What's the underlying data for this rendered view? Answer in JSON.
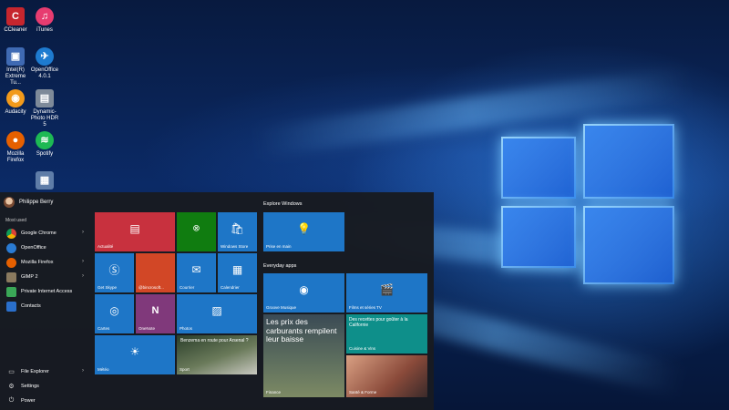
{
  "desktop": {
    "icons": [
      {
        "label": "CCleaner",
        "glyph": "C",
        "color": "#c6262e",
        "icon": "ccleaner-icon"
      },
      {
        "label": "iTunes",
        "glyph": "♫",
        "color": "#e73c70",
        "icon": "itunes-icon"
      },
      {
        "label": "Intel(R) Extreme Tu...",
        "glyph": "▣",
        "color": "#3f6ab3",
        "icon": "intel-icon"
      },
      {
        "label": "OpenOffice 4.0.1",
        "glyph": "✈",
        "color": "#1e7bd0",
        "icon": "openoffice-icon"
      },
      {
        "label": "Audacity",
        "glyph": "◉",
        "color": "#f29a1b",
        "icon": "audacity-icon"
      },
      {
        "label": "Dynamic-Photo HDR 5",
        "glyph": "▤",
        "color": "#7e8a99",
        "icon": "dynamic-photo-icon"
      },
      {
        "label": "Mozilla Firefox",
        "glyph": "●",
        "color": "#e66000",
        "icon": "firefox-icon"
      },
      {
        "label": "Spotify",
        "glyph": "≋",
        "color": "#1db954",
        "icon": "spotify-icon"
      },
      {
        "label": "",
        "glyph": "▦",
        "color": "#5f7da8",
        "icon": "shortcut-icon"
      }
    ]
  },
  "start_menu": {
    "user_name": "Philippe Berry",
    "most_used_title": "Most used",
    "apps": [
      {
        "label": "Google Chrome",
        "color": "#e0a522",
        "has_arrow": true
      },
      {
        "label": "OpenOffice",
        "color": "#2a7bd3",
        "has_arrow": false
      },
      {
        "label": "Mozilla Firefox",
        "color": "#e66000",
        "has_arrow": true
      },
      {
        "label": "GIMP 2",
        "color": "#8a7a5f",
        "has_arrow": true
      },
      {
        "label": "Private Internet Access",
        "color": "#3aa757",
        "has_arrow": false
      },
      {
        "label": "Contacts",
        "color": "#2a6fcb",
        "has_arrow": false
      }
    ],
    "bottom": {
      "file_explorer": "File Explorer",
      "settings": "Settings",
      "power": "Power"
    },
    "tiles": {
      "actualite": "Actualité",
      "xbox": "",
      "store": "Windows Store",
      "skype": "Get Skype",
      "onenote_text": "@bincrosoft...",
      "courrier": "Courrier",
      "calendrier": "Calendrier",
      "cartes": "Cartes",
      "onenote": "OneNote",
      "photos": "Photos",
      "meteo": "Météo",
      "sport_headline": "Benzema en route pour Arsenal ?",
      "sport": "Sport"
    },
    "explore_title": "Explore Windows",
    "prise_en_main": "Prise en main",
    "everyday_title": "Everyday apps",
    "groove": "Groove Musique",
    "films": "Films et séries TV",
    "finance_headline": "Les prix des carburants rempilent leur baisse",
    "finance": "Finance",
    "cuisine_headline": "Des recettes pour goûter à la Californie",
    "cuisine": "Cuisine & Vins",
    "sante": "Santé & Forme"
  }
}
